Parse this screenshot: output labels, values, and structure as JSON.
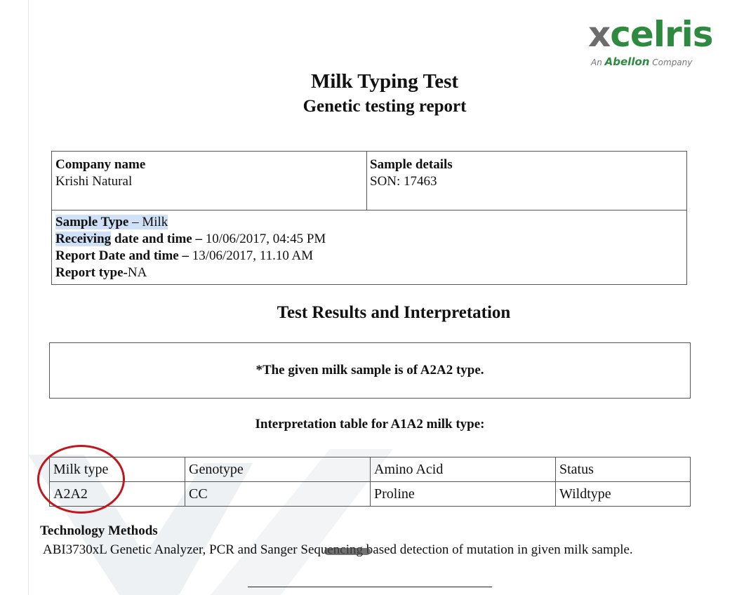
{
  "logo": {
    "wordmark_x": "x",
    "wordmark_rest": "celris",
    "tagline_prefix": "An",
    "tagline_brand": "Abellon",
    "tagline_suffix": "Company",
    "colors": {
      "green": "#2e8a3e",
      "grey": "#6c6c6c"
    }
  },
  "title": "Milk Typing Test",
  "subtitle": "Genetic testing report",
  "info": {
    "company_label": "Company name",
    "company_value": "Krishi Natural",
    "sample_label": "Sample details",
    "sample_value": "SON: 17463",
    "sample_type_label": "Sample Type",
    "sample_type_value": " – Milk",
    "receiving_label_a": "Receiving",
    "receiving_label_b": " date and time – ",
    "receiving_value": "10/06/2017, 04:45 PM",
    "report_date_label": "Report Date and time – ",
    "report_date_value": "13/06/2017, 11.10 AM",
    "report_type_label": "Report type-",
    "report_type_value": "NA"
  },
  "results_title": "Test Results and Interpretation",
  "result_statement": "*The given milk sample is of A2A2 type.",
  "interp_title": "Interpretation table for A1A2 milk type:",
  "interp_table": {
    "headers": [
      "Milk type",
      "Genotype",
      "Amino Acid",
      "Status"
    ],
    "row": [
      "A2A2",
      "CC",
      "Proline",
      "Wildtype"
    ]
  },
  "tech": {
    "title": "Technology Methods",
    "body": "ABI3730xL Genetic Analyzer, PCR and Sanger Sequencing based detection of mutation in given milk sample."
  },
  "annotation_color": "#c0161c",
  "highlight_color": "#cfe0f7"
}
